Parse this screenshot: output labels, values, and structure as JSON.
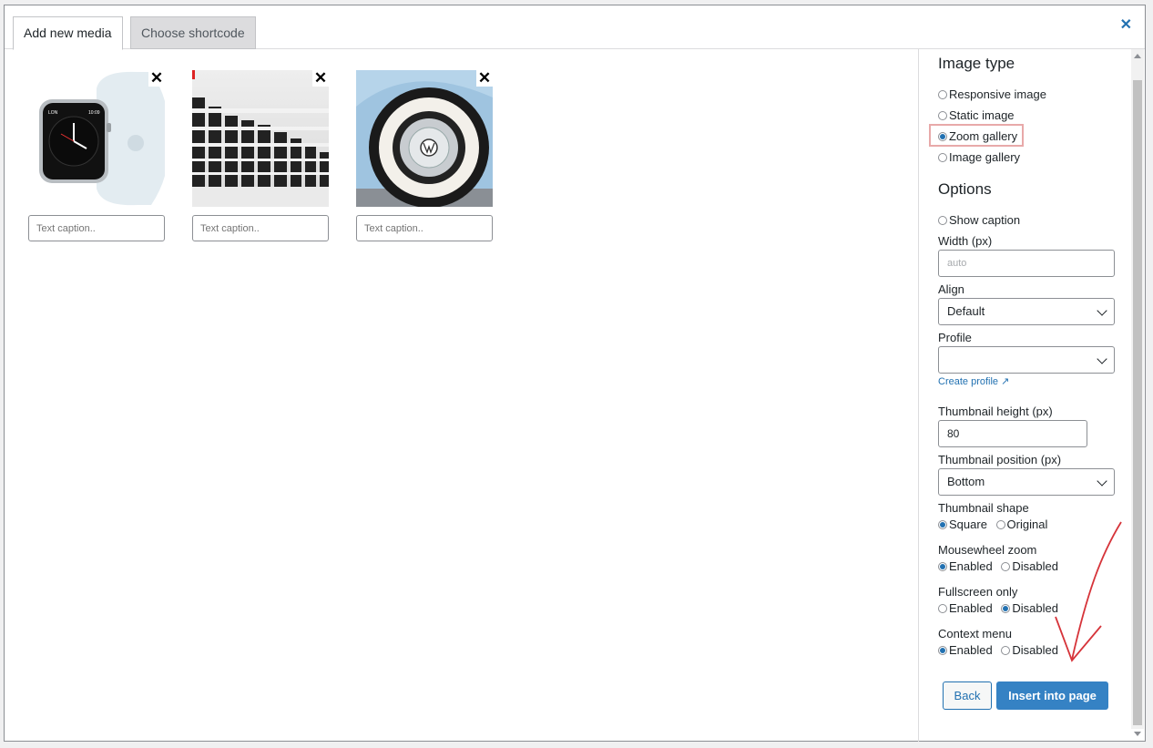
{
  "tabs": [
    "Add new media",
    "Choose shortcode"
  ],
  "media": {
    "remove_glyph": "✕",
    "caption_placeholder": "Text caption.."
  },
  "sidebar": {
    "image_type_heading": "Image type",
    "image_types": [
      "Responsive image",
      "Static image",
      "Zoom gallery",
      "Image gallery"
    ],
    "selected_image_type": "Zoom gallery",
    "options_heading": "Options",
    "show_caption": "Show caption",
    "width_label": "Width (px)",
    "width_placeholder": "auto",
    "align_label": "Align",
    "align_value": "Default",
    "profile_label": "Profile",
    "profile_value": "",
    "create_profile_link": "Create profile ↗",
    "thumb_height_label": "Thumbnail height (px)",
    "thumb_height_value": "80",
    "thumb_position_label": "Thumbnail position (px)",
    "thumb_position_value": "Bottom",
    "thumb_shape_label": "Thumbnail shape",
    "thumb_shape_options": [
      "Square",
      "Original"
    ],
    "mousewheel_label": "Mousewheel zoom",
    "fullscreen_label": "Fullscreen only",
    "context_menu_label": "Context menu",
    "enabled": "Enabled",
    "disabled": "Disabled",
    "back_button": "Back",
    "insert_button": "Insert into page"
  },
  "colors": {
    "accent": "#2271b1",
    "button_primary": "#3582c4",
    "highlight_border": "#e8a9a9",
    "annotation_arrow": "#d6343a"
  }
}
